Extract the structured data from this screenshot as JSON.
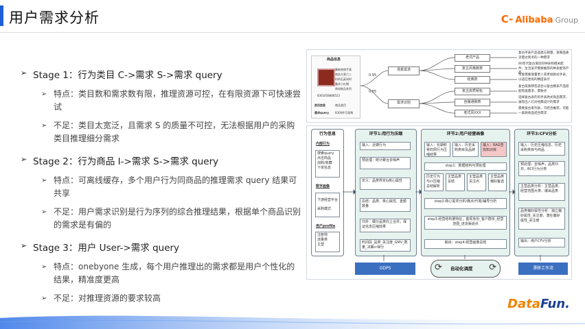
{
  "header": {
    "title": "用户需求分析",
    "brand_logo": "C-",
    "brand_name": "Alibaba",
    "brand_suffix": "Group"
  },
  "stages": [
    {
      "title": "Stage 1：行为类目 C->需求 S->需求 query",
      "points": [
        "特点：类目数和需求数有限，推理资源可控，在有限资源下可快速尝试",
        "不足：类目太宽泛，且需求 S 的质量不可控，无法根据用户的采购类目推理细分需求"
      ]
    },
    {
      "title": "Stage 2：行为商品 I->需求 S->需求 query",
      "points": [
        "特点：可离线缓存，多个用户行为同商品的推理需求 query 结果可共享",
        "不足：用户需求识别是行为序列的综合推理结果，根据单个商品识别的需求是有偏的"
      ]
    },
    {
      "title": "Stage 3：用户 User->需求 query",
      "points": [
        "特点：onebyone 生成，每个用户推理出的需求都是用户个性化的结果，精准度更高",
        "不足：对推理资源的要求较高"
      ]
    }
  ],
  "top_panel": {
    "card_title": "商品信息",
    "card_lines": [
      "最新热销手表",
      "商务大表六三",
      "时尚石英间时",
      "重庆小红帽",
      "休闲商品系列"
    ],
    "card_fields": [
      "类目信息",
      "需求query"
    ],
    "card_values": [
      "商品类目",
      "8300件可采购"
    ],
    "card_code": "8361858868523",
    "mid_nodes": [
      "场景需求",
      "需求识别"
    ],
    "edge_labels": [
      "0.95",
      "0.85"
    ],
    "right_nodes": [
      "老式产品",
      "复古风格腕表",
      "经典款",
      "复古皮质钥包",
      "自播通腕表",
      "老式风XXX"
    ],
    "notes": [
      "复古手表产品品类与销量，紧跟品质流量达到点的一种需求",
      "80年代复古潮流的钟表和相关配件，生活美学需要推荐的钟表配饰产品",
      "可能需要放置老人或老样款式手表，以适应更高的精度表示",
      "复古皮质钥包适合以复古腕表产品搭配有类需求，需要点",
      "选择复古表的的手表款式商品需求，展现出人们对经典设计的需求",
      "需要复古系列表，可结合推荐，可能一类款商品结合需求"
    ]
  },
  "flow": {
    "columns": [
      {
        "title": "行为信息",
        "sections": [
          "内部行为",
          "数字画像",
          "用户profile"
        ],
        "items": [
          "搜索query",
          "点击商品",
          "加购/收藏",
          "下单信息",
          "下游经营平台",
          "采购模式",
          "注册地",
          "流量类",
          "主营"
        ]
      },
      {
        "title": "环节1:用行为压缩",
        "items": [
          "输入：近期行为",
          "预处理：统计聚合去噪声",
          "定义：品类界定&核心属性",
          "总结：品类、核心属性、金额数量",
          "归并：细分品类向上合并，保证信息压缩效果",
          "时间段_品类_关注度_GMV_数量_决策cr得分"
        ]
      },
      {
        "title": "环节2:用户经营画像",
        "items": [
          "输入：长期积累的周行为压缩结果",
          "输入：历史采购类目及品牌",
          "输入：RAG查找知识库",
          "step1：数据结构与预处理",
          "历史行为与cr压缩总结解析",
          "主营品类总结",
          "主营品类关注点",
          "主营品类偏好备选",
          "step2:核心需求分析/痛点/代笔/辅导分析",
          "step3:经营结构量特征，套现身份_客户群体_经营范围_进货渠道点",
          "输出：step4:经营画像总结"
        ]
      },
      {
        "title": "环节3:CFV分析",
        "items": [
          "输入：历史压缩信息、历史采购类目与商品",
          "预处理：去噪声，品类归并，BCI行为分类",
          "主营品类分析：主营品类、经营范围大类、爆采品类",
          "品类偏好属性分析：独立偏好属性_关注度，潜在偏好属性_关注度",
          "输出：用户CFV分析"
        ]
      }
    ],
    "bottom": {
      "left": "ODPS",
      "middle": "自动化调度",
      "right": "漂移工作流"
    }
  },
  "footer": {
    "brand_part1": "Data",
    "brand_part2": "Fun."
  }
}
